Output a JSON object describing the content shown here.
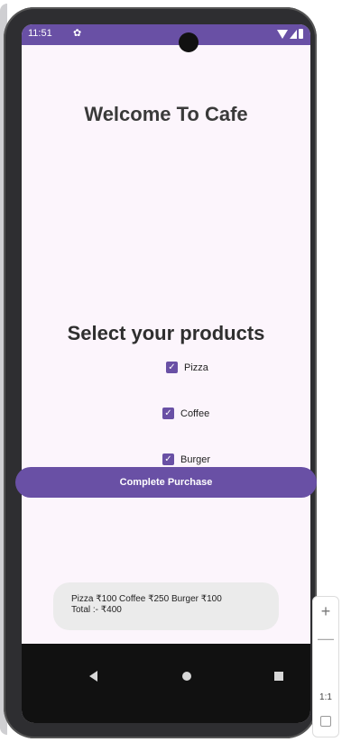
{
  "status_bar": {
    "time": "11:51",
    "gear_glyph": "✿",
    "icons": [
      "settings-icon",
      "wifi-icon",
      "signal-icon",
      "battery-icon"
    ]
  },
  "app": {
    "title": "Welcome To Cafe",
    "subtitle": "Select your products",
    "products": [
      {
        "label": "Pizza",
        "checked": true
      },
      {
        "label": "Coffee",
        "checked": true
      },
      {
        "label": "Burger",
        "checked": true
      }
    ],
    "purchase_button": "Complete Purchase",
    "toast": {
      "line1": "Pizza ₹100  Coffee ₹250  Burger ₹100",
      "line2": "Total :- ₹400"
    }
  },
  "emulator_controls": {
    "zoom_in": "+",
    "zoom_out": "—",
    "ratio": "1:1"
  },
  "colors": {
    "accent": "#6950a5",
    "screen_bg": "#fcf5fc",
    "toast_bg": "#ebebeb",
    "nav_bg": "#111111"
  }
}
